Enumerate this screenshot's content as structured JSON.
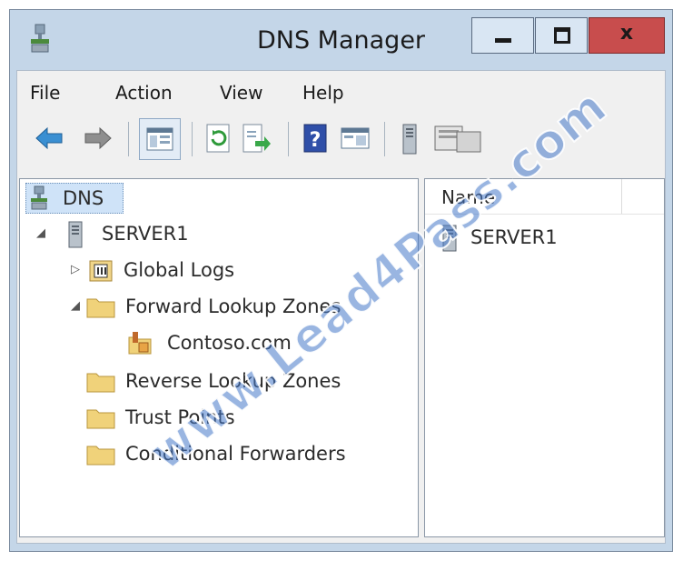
{
  "window": {
    "title": "DNS Manager",
    "close_glyph": "x",
    "colors": {
      "frame": "#c4d6e8",
      "close": "#c84d4d",
      "selection": "#cfe3f8",
      "folder": "#f0d27a"
    }
  },
  "menu": {
    "items": [
      "File",
      "Action",
      "View",
      "Help"
    ]
  },
  "toolbar": {
    "icons": [
      "back-arrow-icon",
      "forward-arrow-icon",
      "console-tree-icon",
      "refresh-icon",
      "export-list-icon",
      "help-icon",
      "properties-panel-icon",
      "server-icon",
      "new-zone-icon"
    ]
  },
  "tree": {
    "root": "DNS",
    "server": "SERVER1",
    "nodes": [
      {
        "label": "Global Logs",
        "icon": "log-icon",
        "expander": "collapsed"
      },
      {
        "label": "Forward Lookup Zones",
        "icon": "folder-icon",
        "expander": "expanded"
      },
      {
        "label": "Contoso.com",
        "icon": "zone-icon",
        "expander": "none"
      },
      {
        "label": "Reverse Lookup Zones",
        "icon": "folder-icon",
        "expander": "none"
      },
      {
        "label": "Trust Points",
        "icon": "folder-icon",
        "expander": "none"
      },
      {
        "label": "Conditional Forwarders",
        "icon": "folder-icon",
        "expander": "none"
      }
    ]
  },
  "list": {
    "column": "Name",
    "rows": [
      "SERVER1"
    ]
  },
  "watermark": "www.Lead4Pass.com"
}
